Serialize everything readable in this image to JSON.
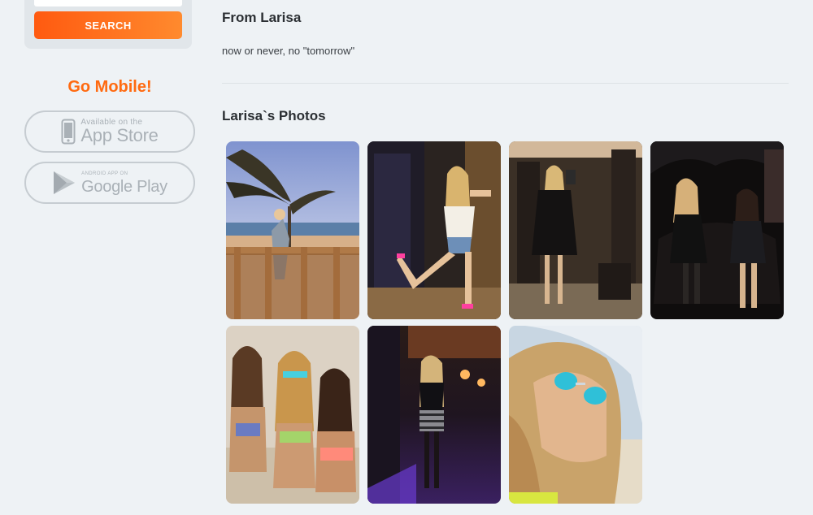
{
  "search": {
    "button_label": "SEARCH"
  },
  "mobile": {
    "heading": "Go Mobile!",
    "app_store": {
      "small": "Available on the",
      "big": "App Store"
    },
    "google_play": {
      "small": "ANDROID APP ON",
      "big": "Google Play"
    }
  },
  "profile": {
    "from_heading": "From Larisa",
    "about": "now or never, no \"tomorrow\"",
    "photos_heading": "Larisa`s Photos"
  },
  "colors": {
    "accent": "#ff6a10",
    "button_start": "#ff5a10",
    "button_end": "#ff8a2e",
    "background": "#eef2f5"
  },
  "photos": [
    {
      "scene": "beach-palm-railing"
    },
    {
      "scene": "mirror-selfie-hallway"
    },
    {
      "scene": "mirror-selfie-black-dress"
    },
    {
      "scene": "two-women-dark-chair"
    },
    {
      "scene": "three-women-beach-sunglasses"
    },
    {
      "scene": "nightclub-striped-skirt"
    },
    {
      "scene": "close-up-blue-sunglasses"
    }
  ]
}
